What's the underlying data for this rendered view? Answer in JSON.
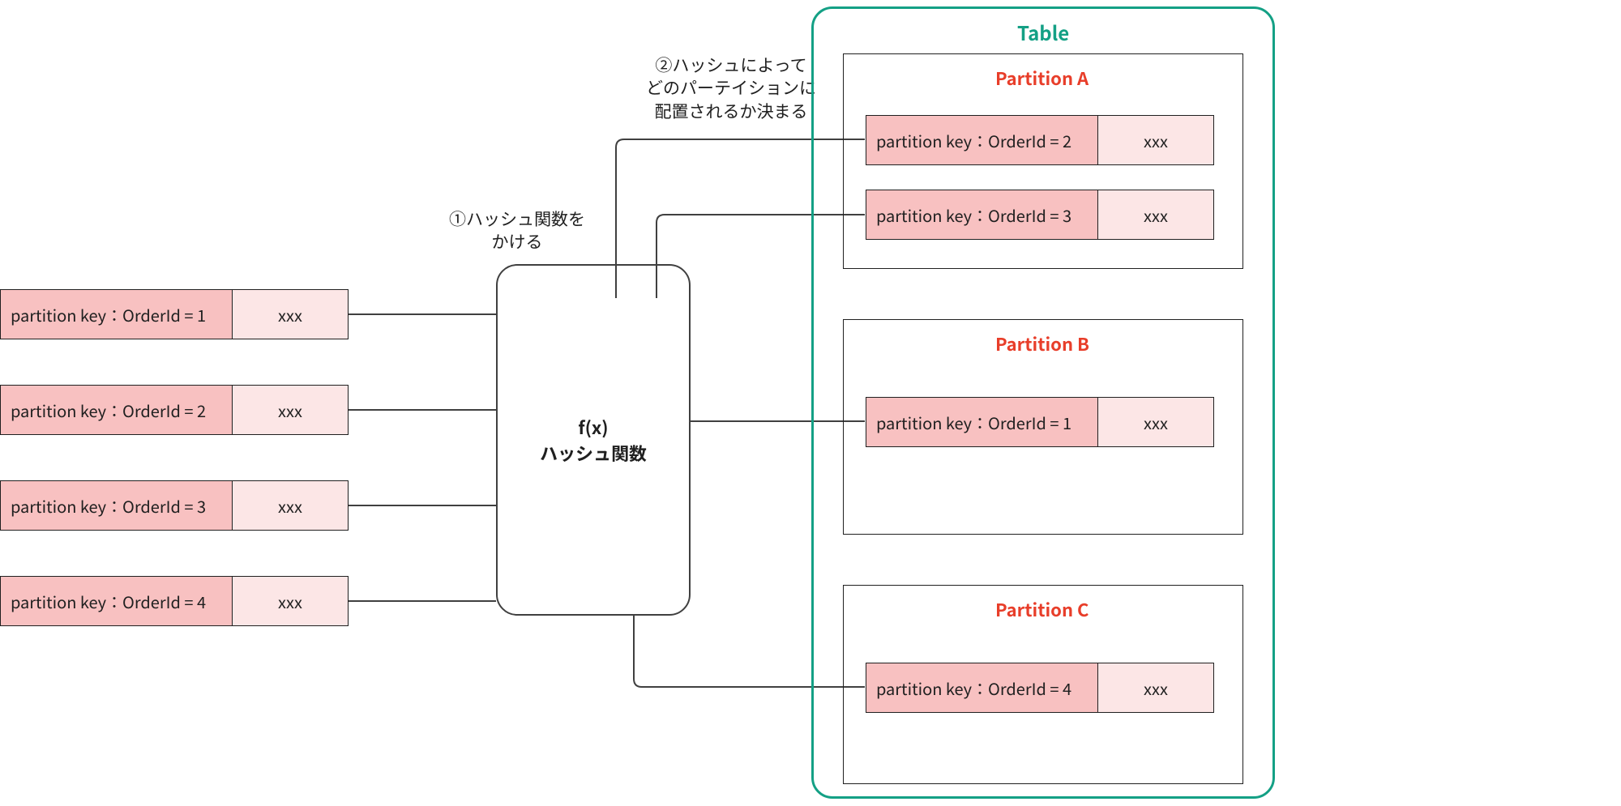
{
  "tableTitle": "Table",
  "hashBox": {
    "fx": "f(x)",
    "label": "ハッシュ関数"
  },
  "annot1": {
    "l1": "①ハッシュ関数を",
    "l2": "かける"
  },
  "annot2": {
    "l1": "②ハッシュによって",
    "l2": "どのパーテイションに",
    "l3": "配置されるか決まる"
  },
  "inputRecords": [
    {
      "key": "partition key：OrderId = 1",
      "val": "xxx"
    },
    {
      "key": "partition key：OrderId = 2",
      "val": "xxx"
    },
    {
      "key": "partition key：OrderId = 3",
      "val": "xxx"
    },
    {
      "key": "partition key：OrderId = 4",
      "val": "xxx"
    }
  ],
  "partitions": [
    {
      "title": "Partition A",
      "records": [
        {
          "key": "partition key：OrderId = 2",
          "val": "xxx"
        },
        {
          "key": "partition key：OrderId = 3",
          "val": "xxx"
        }
      ]
    },
    {
      "title": "Partition B",
      "records": [
        {
          "key": "partition key：OrderId = 1",
          "val": "xxx"
        }
      ]
    },
    {
      "title": "Partition C",
      "records": [
        {
          "key": "partition key：OrderId = 4",
          "val": "xxx"
        }
      ]
    }
  ]
}
